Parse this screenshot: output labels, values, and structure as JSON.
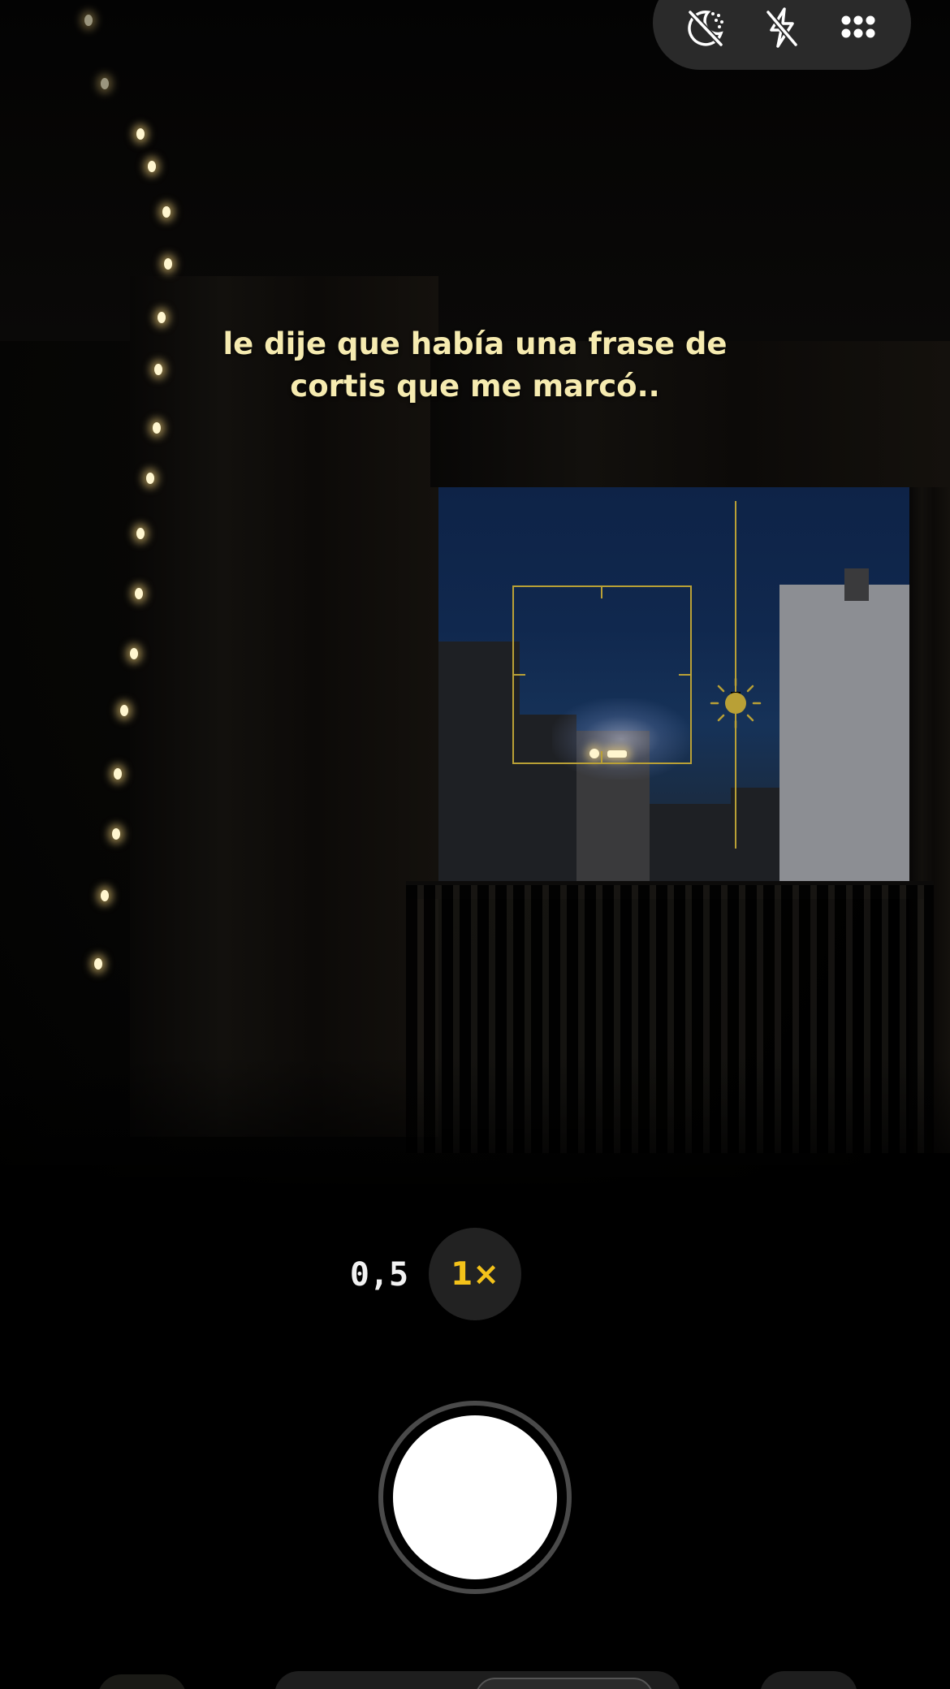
{
  "caption": {
    "line1": "le dije que había una frase de",
    "line2": "cortis que me marcó.."
  },
  "top_controls": {
    "icons": [
      "night-mode-off-icon",
      "flash-off-icon",
      "more-options-icon"
    ]
  },
  "zoom": {
    "options": [
      "0,5",
      "1×"
    ],
    "selected": "1×"
  },
  "viewfinder": {
    "focus_box": "focus-frame",
    "exposure_indicator": "sun-icon"
  },
  "shutter": {
    "icon": "shutter-button"
  },
  "colors": {
    "accent": "#f3c21a",
    "focus": "#b9a036",
    "caption": "#f6ebb0",
    "pill_bg": "#2a2a2a",
    "zoom_bg": "#222222"
  }
}
